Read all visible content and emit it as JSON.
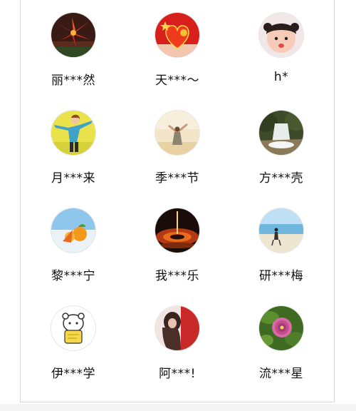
{
  "users": [
    {
      "name": "丽***然",
      "avatar": "red-flower-avatar-icon"
    },
    {
      "name": "天***～",
      "avatar": "red-heart-flag-avatar-icon"
    },
    {
      "name": "h*",
      "avatar": "child-avatar-icon"
    },
    {
      "name": "月***来",
      "avatar": "cartoon-woman-avatar-icon"
    },
    {
      "name": "季***节",
      "avatar": "woman-desert-avatar-icon"
    },
    {
      "name": "方***壳",
      "avatar": "waterfall-avatar-icon"
    },
    {
      "name": "黎***宁",
      "avatar": "fruit-sky-avatar-icon"
    },
    {
      "name": "我***乐",
      "avatar": "water-drop-avatar-icon"
    },
    {
      "name": "研***梅",
      "avatar": "beach-person-avatar-icon"
    },
    {
      "name": "伊***学",
      "avatar": "cartoon-bear-avatar-icon"
    },
    {
      "name": "阿***!",
      "avatar": "woman-red-avatar-icon"
    },
    {
      "name": "流***星",
      "avatar": "pink-flower-avatar-icon"
    }
  ]
}
